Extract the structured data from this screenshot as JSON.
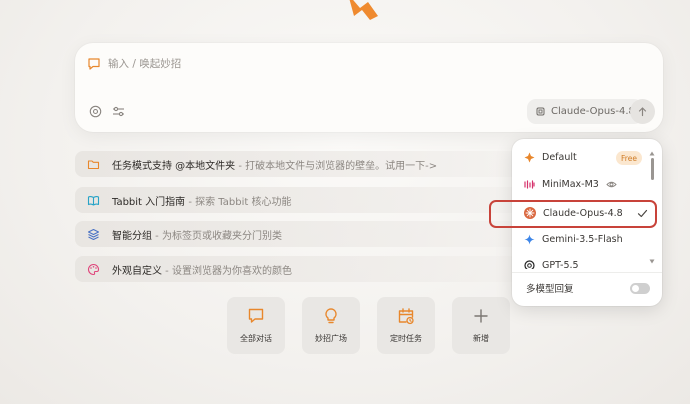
{
  "input": {
    "placeholder": "输入 / 唤起妙招",
    "model_label": "Claude-Opus-4.8"
  },
  "suggestions": [
    {
      "title": "任务模式支持 @本地文件夹",
      "desc": " - 打破本地文件与浏览器的壁垒。试用一下->",
      "icon": "folder-icon"
    },
    {
      "title": "Tabbit 入门指南",
      "desc": " - 探索 Tabbit 核心功能",
      "icon": "book-icon"
    },
    {
      "title": "智能分组",
      "desc": " - 为标签页或收藏夹分门别类",
      "icon": "layers-icon"
    },
    {
      "title": "外观自定义",
      "desc": " - 设置浏览器为你喜欢的颜色",
      "icon": "palette-icon"
    }
  ],
  "quick_actions": [
    {
      "label": "全部对话",
      "icon": "chat-icon"
    },
    {
      "label": "妙招广场",
      "icon": "lightbulb-icon"
    },
    {
      "label": "定时任务",
      "icon": "calendar-clock-icon"
    },
    {
      "label": "新增",
      "icon": "plus-icon"
    }
  ],
  "model_dropdown": {
    "items": [
      {
        "name": "Default",
        "badge": "Free"
      },
      {
        "name": "MiniMax-M3"
      },
      {
        "name": "Claude-Opus-4.8",
        "selected": true
      },
      {
        "name": "Gemini-3.5-Flash"
      },
      {
        "name": "GPT-5.5"
      }
    ],
    "multi_model_label": "多模型回复",
    "multi_model_enabled": false
  },
  "colors": {
    "accent": "#e8872c",
    "highlight": "#c8433a",
    "book": "#27a3c7",
    "layers": "#4a72c4",
    "palette": "#e0457b"
  }
}
